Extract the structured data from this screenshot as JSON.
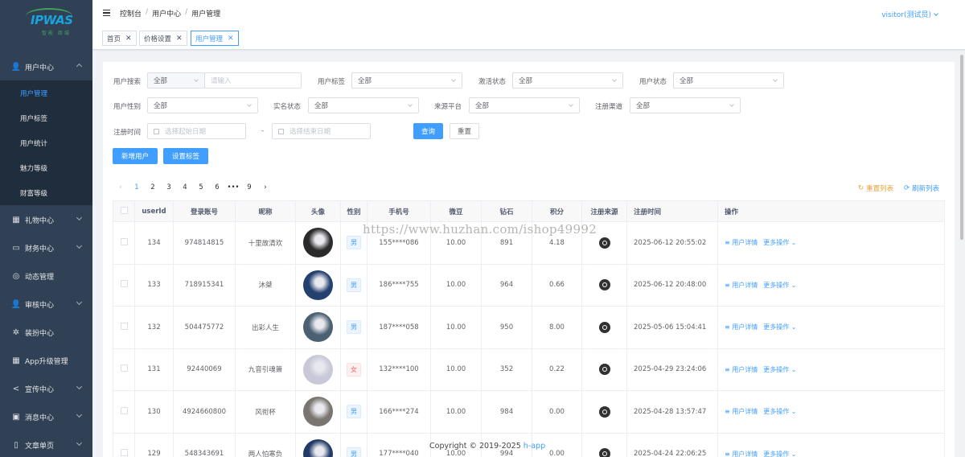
{
  "logo": {
    "text": "IPWAS",
    "sub": "智能 商城"
  },
  "sidebar": {
    "top_partial": "",
    "menus": [
      {
        "label": "用户中心",
        "icon": "user-icon",
        "arrow": "up"
      },
      {
        "label": "礼物中心",
        "icon": "gift-icon",
        "arrow": "down"
      },
      {
        "label": "财务中心",
        "icon": "wallet-icon",
        "arrow": "down"
      },
      {
        "label": "动态管理",
        "icon": "moments-icon",
        "arrow": ""
      },
      {
        "label": "审核中心",
        "icon": "audit-icon",
        "arrow": "down"
      },
      {
        "label": "装扮中心",
        "icon": "sparkle-icon",
        "arrow": ""
      },
      {
        "label": "App升级管理",
        "icon": "grid-icon",
        "arrow": ""
      },
      {
        "label": "宣传中心",
        "icon": "share-icon",
        "arrow": "down"
      },
      {
        "label": "消息中心",
        "icon": "message-icon",
        "arrow": "down"
      },
      {
        "label": "文章单页",
        "icon": "book-icon",
        "arrow": "down"
      }
    ],
    "sub_items": [
      "用户管理",
      "用户标签",
      "用户统计",
      "魅力等级",
      "财富等级"
    ]
  },
  "header": {
    "breadcrumb": [
      "控制台",
      "用户中心",
      "用户管理"
    ],
    "user": "visitor(测试员)"
  },
  "tags": [
    {
      "label": "首页",
      "close": "✕"
    },
    {
      "label": "价格设置",
      "close": "✕"
    },
    {
      "label": "用户管理",
      "close": "✕"
    }
  ],
  "filters": {
    "search_label": "用户搜索",
    "search_scope": "全部",
    "search_placeholder": "请输入",
    "tag_label": "用户标签",
    "tag_value": "全部",
    "active_label": "激活状态",
    "active_value": "全部",
    "status_label": "用户状态",
    "status_value": "全部",
    "gender_label": "用户性别",
    "gender_value": "全部",
    "realname_label": "实名状态",
    "realname_value": "全部",
    "platform_label": "来源平台",
    "platform_value": "全部",
    "channel_label": "注册渠道",
    "channel_value": "全部",
    "time_label": "注册时间",
    "start_placeholder": "选择起始日期",
    "dash": "-",
    "end_placeholder": "选择结束日期",
    "query_btn": "查询",
    "reset_btn": "重置"
  },
  "actions": {
    "add_user": "新增用户",
    "set_tag": "设置标签",
    "reset_list": "重置列表",
    "refresh_list": "刷新列表"
  },
  "pager": {
    "pages": [
      "1",
      "2",
      "3",
      "4",
      "5",
      "6",
      "•••",
      "9"
    ],
    "prev": "‹",
    "next": "›",
    "current": "1"
  },
  "table": {
    "headers": [
      "userId",
      "登录账号",
      "昵称",
      "头像",
      "性别",
      "手机号",
      "微豆",
      "钻石",
      "积分",
      "注册来源",
      "注册时间",
      "操作"
    ],
    "detail_label": "用户详情",
    "more_label": "更多操作",
    "rows": [
      {
        "id": "134",
        "account": "974814815",
        "nick": "十里故清欢",
        "gender": "男",
        "g": "m",
        "phone": "155****086",
        "beans": "10.00",
        "diamond": "891",
        "points": "4.18",
        "time": "2025-06-12 20:55:02",
        "avatar_color": "#2b2b2b"
      },
      {
        "id": "133",
        "account": "718915341",
        "nick": "沐桀",
        "gender": "男",
        "g": "m",
        "phone": "186****755",
        "beans": "10.00",
        "diamond": "964",
        "points": "0.66",
        "time": "2025-06-12 20:48:00",
        "avatar_color": "#24406e"
      },
      {
        "id": "132",
        "account": "504475772",
        "nick": "出彩人生",
        "gender": "男",
        "g": "m",
        "phone": "187****058",
        "beans": "10.00",
        "diamond": "950",
        "points": "8.00",
        "time": "2025-05-06 15:04:41",
        "avatar_color": "#4b6073"
      },
      {
        "id": "131",
        "account": "92440069",
        "nick": "九音引魂箫",
        "gender": "女",
        "g": "f",
        "phone": "132****100",
        "beans": "10.00",
        "diamond": "352",
        "points": "0.22",
        "time": "2025-04-29 23:24:06",
        "avatar_color": "#c8c8d8"
      },
      {
        "id": "130",
        "account": "4924660800",
        "nick": "风衔杯",
        "gender": "男",
        "g": "m",
        "phone": "166****274",
        "beans": "10.00",
        "diamond": "984",
        "points": "0.00",
        "time": "2025-04-28 13:57:47",
        "avatar_color": "#7a7570"
      },
      {
        "id": "129",
        "account": "548343691",
        "nick": "两人怕寒负",
        "gender": "男",
        "g": "m",
        "phone": "177****040",
        "beans": "10.00",
        "diamond": "994",
        "points": "0.00",
        "time": "2025-04-24 22:06:25",
        "avatar_color": "#223a66"
      }
    ]
  },
  "watermark": "https://www.huzhan.com/ishop49992",
  "footer": {
    "text": "Copyright © 2019-2025 ",
    "link": "h-app"
  }
}
